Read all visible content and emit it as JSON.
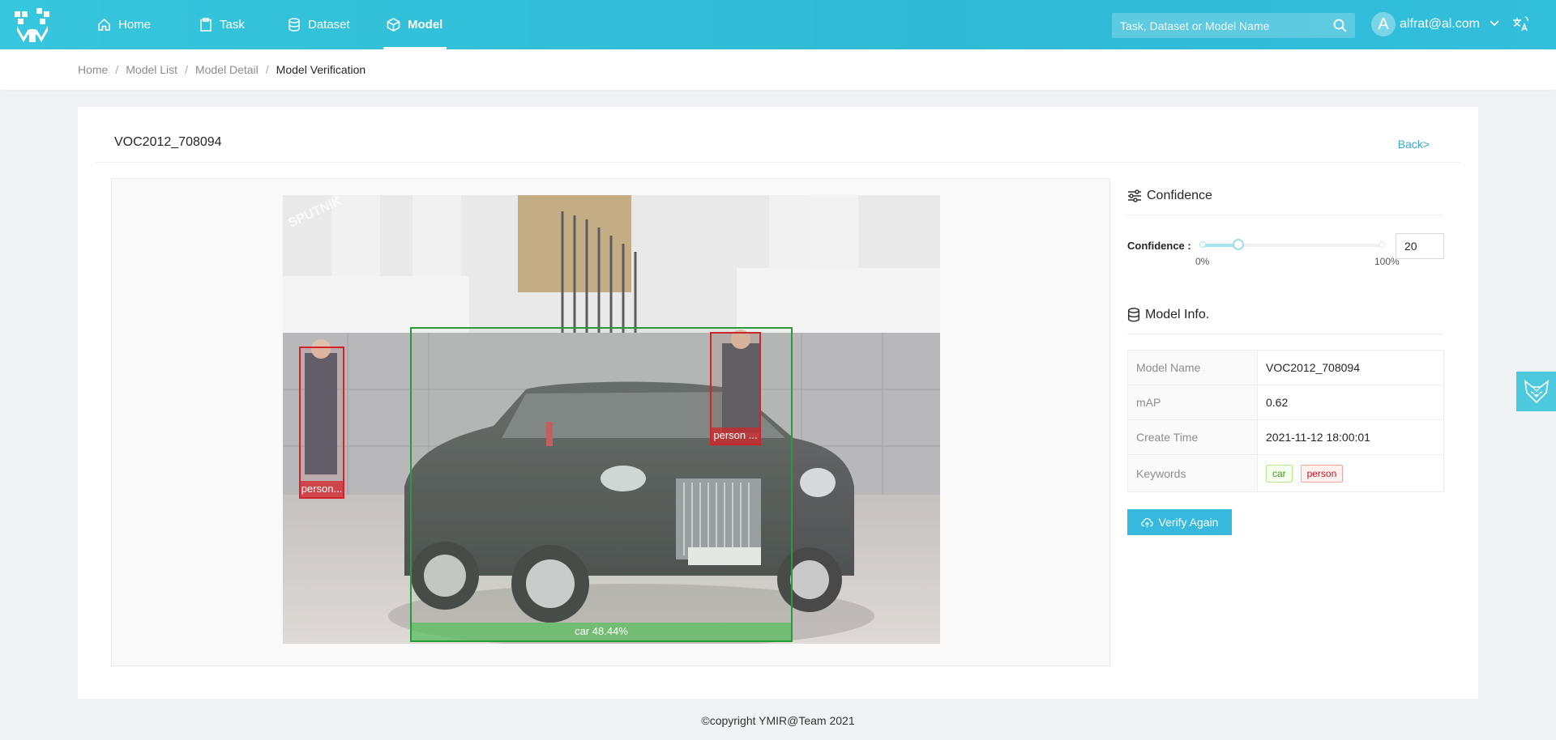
{
  "nav": {
    "items": [
      {
        "label": "Home",
        "icon": "home-icon"
      },
      {
        "label": "Task",
        "icon": "task-icon"
      },
      {
        "label": "Dataset",
        "icon": "dataset-icon"
      },
      {
        "label": "Model",
        "icon": "model-icon",
        "active": true
      }
    ],
    "search_placeholder": "Task, Dataset or Model Name",
    "avatar_letter": "A",
    "user_email": "alfrat@al.com"
  },
  "breadcrumb": [
    "Home",
    "Model List",
    "Model Detail",
    "Model Verification"
  ],
  "page": {
    "title": "VOC2012_708094",
    "back_label": "Back>"
  },
  "detections": [
    {
      "label": "person...",
      "color": "#d4232b"
    },
    {
      "label": "person ...",
      "color": "#d4232b"
    },
    {
      "label": "car 48.44%",
      "color": "#2b9a3b"
    }
  ],
  "confidence": {
    "section_title": "Confidence",
    "label": "Confidence :",
    "value": "20",
    "min_mark": "0%",
    "max_mark": "100%",
    "fraction": 0.2
  },
  "model_info": {
    "section_title": "Model Info.",
    "rows": [
      {
        "key": "Model Name",
        "value": "VOC2012_708094"
      },
      {
        "key": "mAP",
        "value": "0.62"
      },
      {
        "key": "Create Time",
        "value": "2021-11-12 18:00:01"
      }
    ],
    "keywords_label": "Keywords",
    "keywords": [
      "car",
      "person"
    ]
  },
  "verify_label": "Verify Again",
  "footer": "©copyright YMIR@Team 2021",
  "colors": {
    "accent": "#36b9dd",
    "nav": "#32bfdb"
  }
}
